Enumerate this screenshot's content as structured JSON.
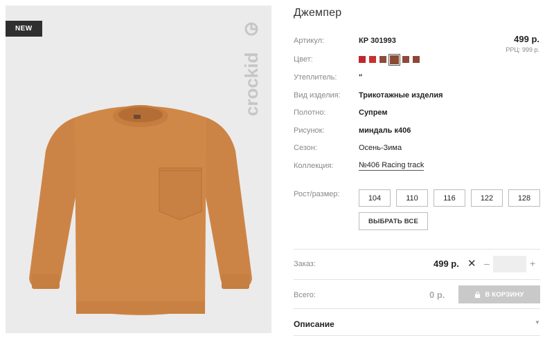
{
  "product": {
    "badge": "NEW",
    "brand_logo": "crockid",
    "title": "Джемпер"
  },
  "specs": {
    "article": {
      "label": "Артикул:",
      "value": "КР 301993"
    },
    "color": {
      "label": "Цвет:",
      "swatches": [
        "#c0272d",
        "#c8302e",
        "#8e4a3a",
        "#8a4a33",
        "#8e4b3b",
        "#8d4737"
      ],
      "selected_index": 3
    },
    "insulation": {
      "label": "Утеплитель:",
      "value": "\""
    },
    "item_type": {
      "label": "Вид изделия:",
      "value": "Трикотажные изделия"
    },
    "fabric": {
      "label": "Полотно:",
      "value": "Супрем"
    },
    "pattern": {
      "label": "Рисунок:",
      "value": "миндаль к406"
    },
    "season": {
      "label": "Сезон:",
      "value": "Осень-Зима"
    },
    "collection": {
      "label": "Коллекция:",
      "value": "№406 Racing track"
    }
  },
  "pricing": {
    "price": "499 р.",
    "rrp": "РРЦ: 999 р."
  },
  "sizes": {
    "label": "Рост/размер:",
    "options": [
      "104",
      "110",
      "116",
      "122",
      "128"
    ],
    "select_all": "ВЫБРАТЬ ВСЕ"
  },
  "order": {
    "label": "Заказ:",
    "price": "499 р.",
    "remove_icon": "times-icon",
    "decrement": "–",
    "increment": "+",
    "quantity": ""
  },
  "total": {
    "label": "Всего:",
    "value": "0 р.",
    "cart_button": "В КОРЗИНУ",
    "cart_icon": "lock-icon"
  },
  "description": {
    "label": "Описание",
    "caret_icon": "caret-down-icon"
  },
  "colors": {
    "garment": "#d08848",
    "photo_bg": "#ebebeb",
    "badge_bg": "#2f2f2f"
  }
}
